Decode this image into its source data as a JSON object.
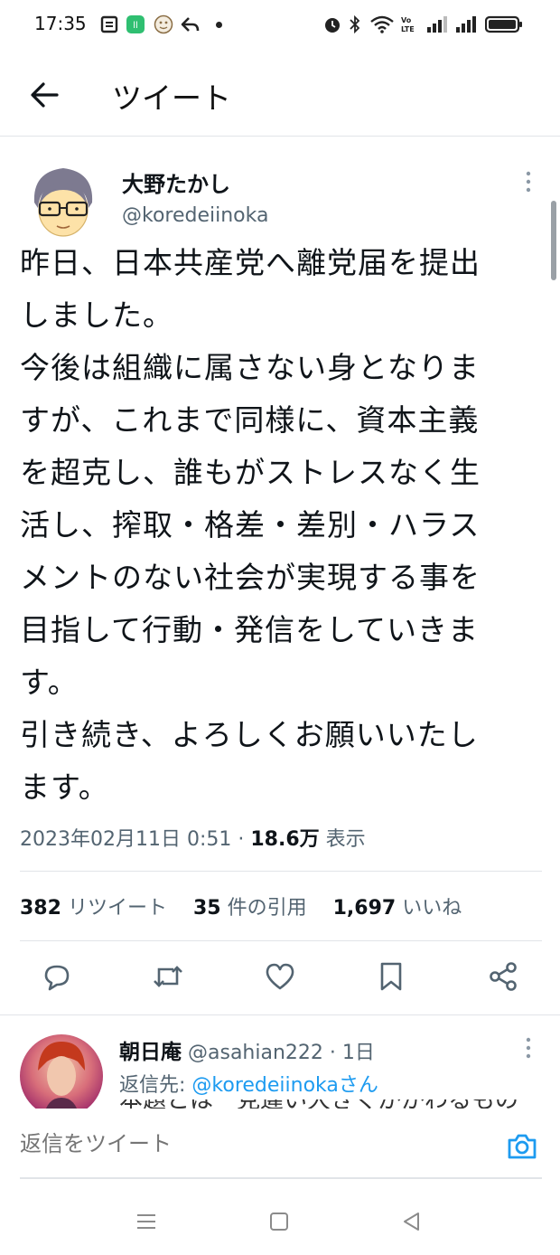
{
  "status_bar": {
    "time": "17:35",
    "left_icons": [
      "notification-icon",
      "line-app-icon",
      "chat-app-icon",
      "reply-arrow-icon",
      "dot-icon"
    ],
    "right_icons": [
      "alarm-icon",
      "bluetooth-icon",
      "wifi-icon",
      "volte-icon",
      "signal-icon",
      "signal-icon",
      "battery-icon"
    ]
  },
  "header": {
    "title": "ツイート"
  },
  "tweet": {
    "display_name": "大野たかし",
    "handle": "@koredeiinoka",
    "lines": [
      "昨日、日本共産党へ離党届を提出",
      "しました。",
      "今後は組織に属さない身となりま",
      "すが、これまで同様に、資本主義",
      "を超克し、誰もがストレスなく生",
      "活し、搾取・格差・差別・ハラス",
      "メントのない社会が実現する事を",
      "目指して行動・発信をしていきま",
      "す。",
      "引き続き、よろしくお願いいたし",
      "ます。"
    ],
    "timestamp": "2023年02月11日 0:51",
    "separator": "·",
    "views_count": "18.6万",
    "views_label": "表示",
    "retweets_count": "382",
    "retweets_label": "リツイート",
    "quotes_count": "35",
    "quotes_label": "件の引用",
    "likes_count": "1,697",
    "likes_label": "いいね"
  },
  "actions": [
    "reply-icon",
    "retweet-icon",
    "like-icon",
    "bookmark-icon",
    "share-icon"
  ],
  "reply": {
    "display_name": "朝日庵",
    "handle": "@asahian222",
    "separator": "·",
    "time": "1日",
    "reply_to_prefix": "返信先: ",
    "reply_to_handle": "@koredeiinokaさん",
    "partial_text": "本題とは一見違い大きくかかわるもの"
  },
  "compose": {
    "placeholder": "返信をツイート"
  },
  "colors": {
    "accent": "#1d9bf0",
    "text_primary": "#0f1419",
    "text_secondary": "#536471",
    "divider": "#e1e4e8"
  }
}
